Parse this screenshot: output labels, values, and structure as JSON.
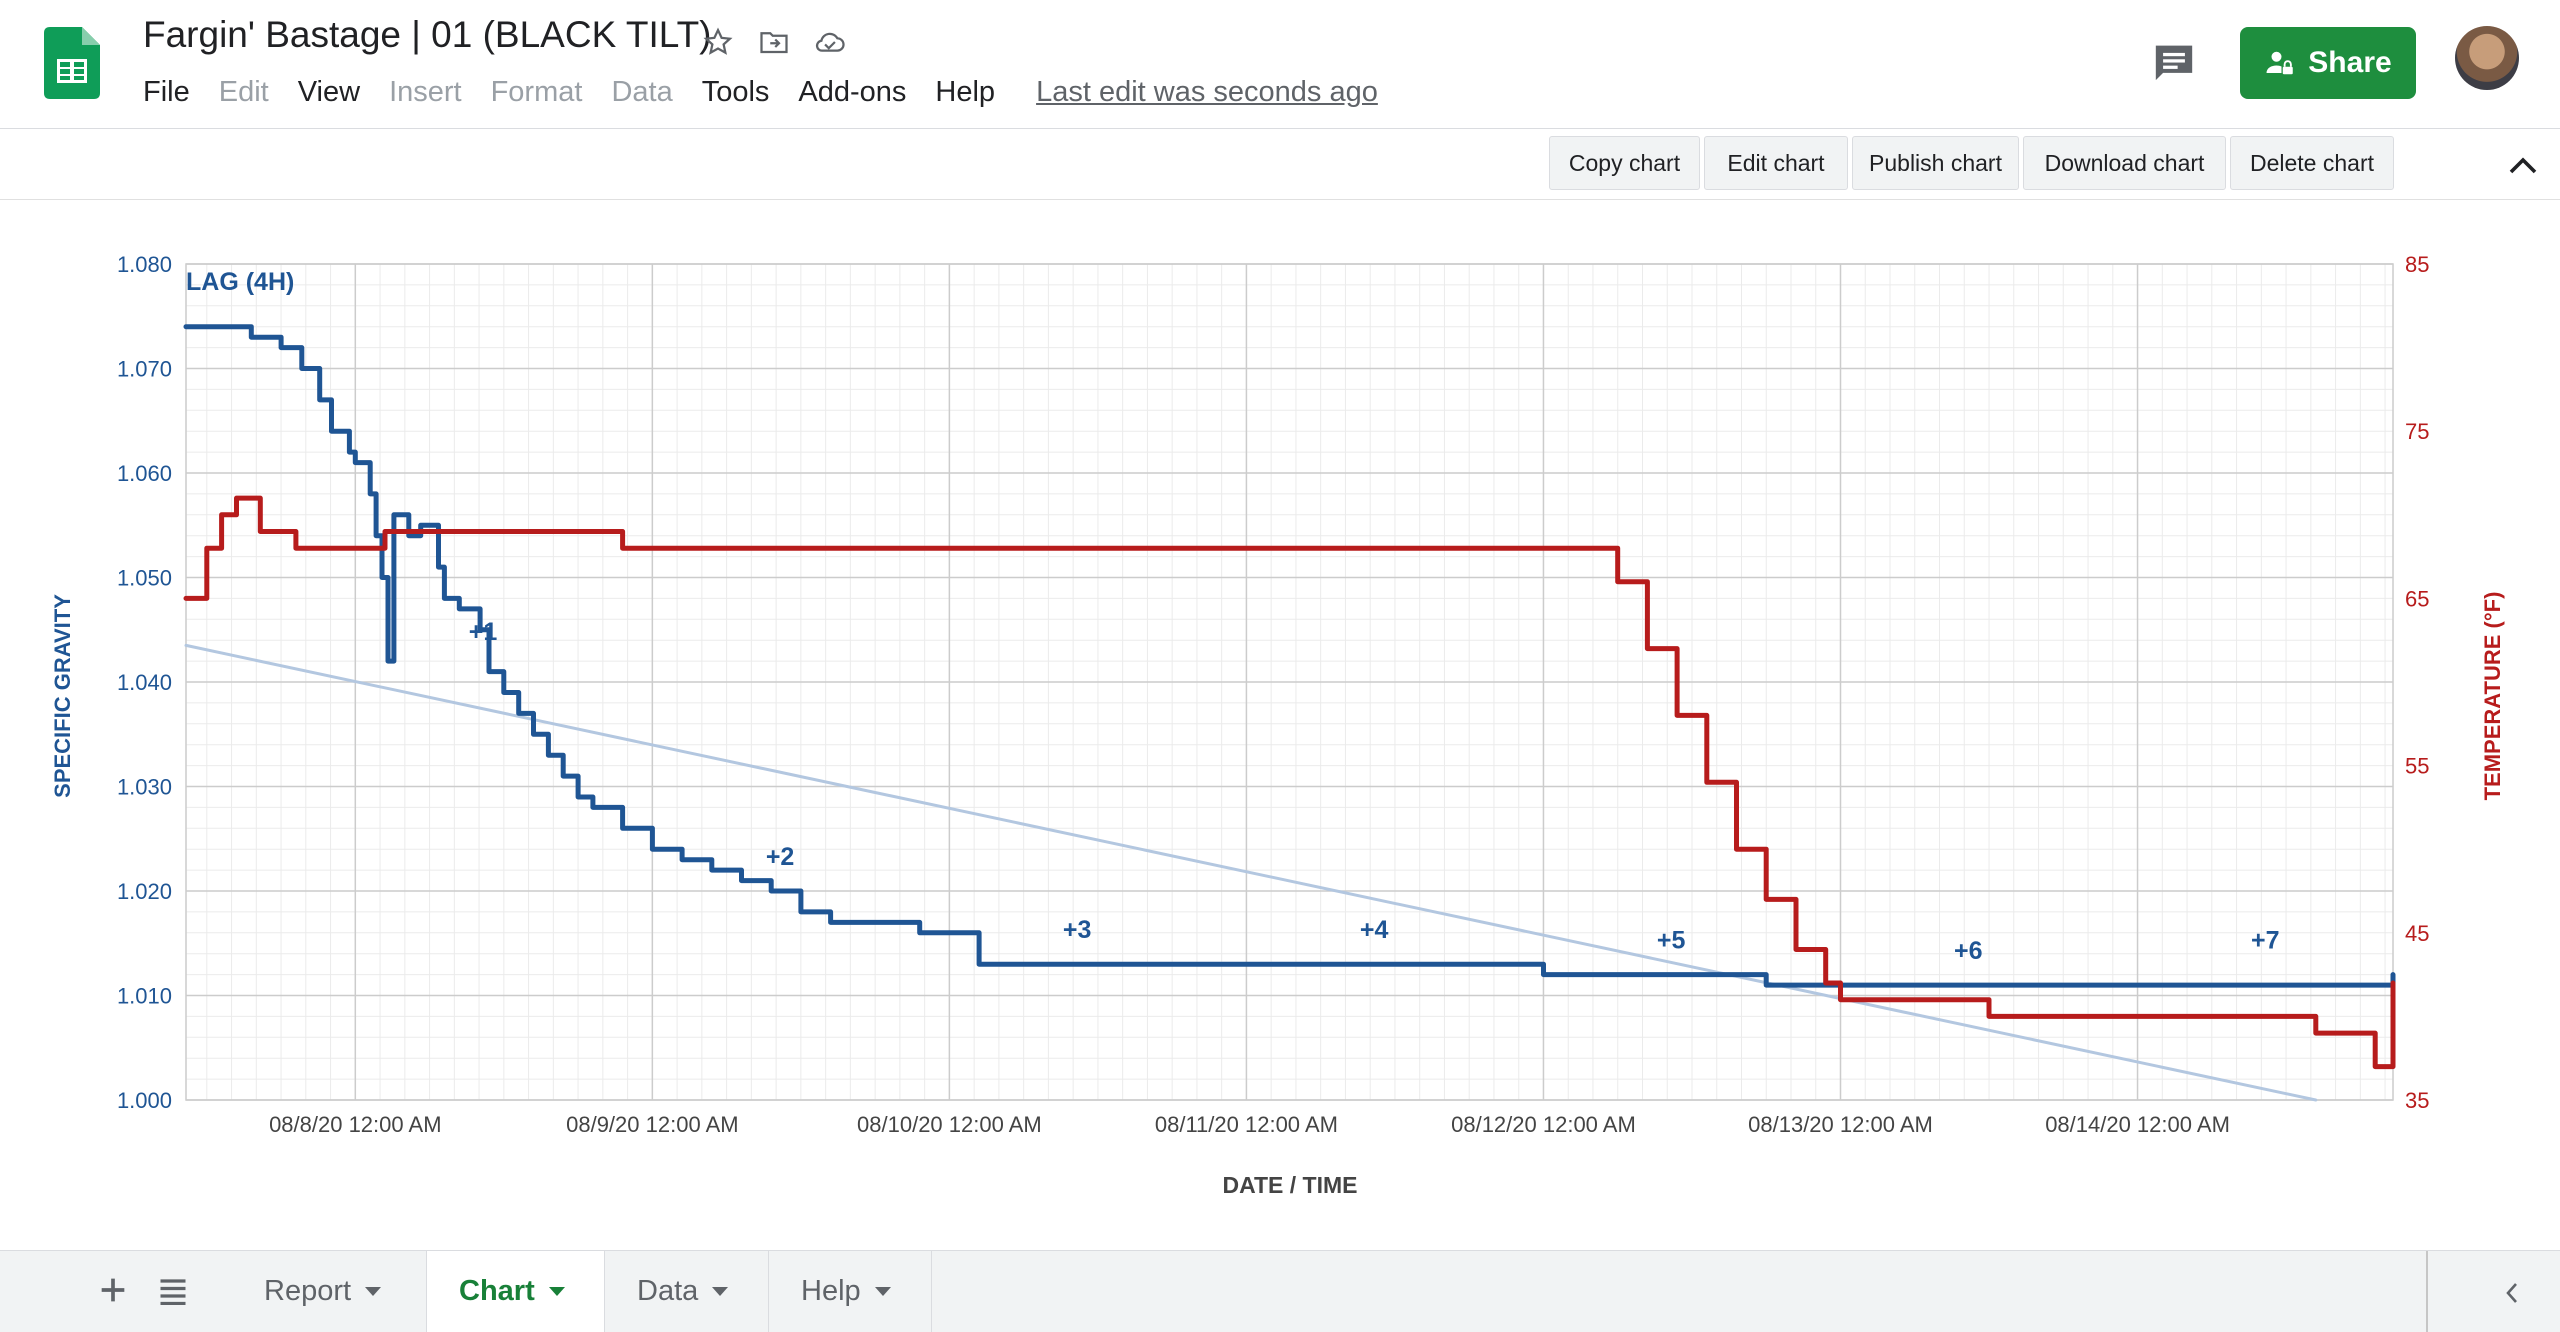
{
  "app": {
    "title": "Fargin' Bastage | 01 (BLACK TILT)",
    "last_edit": "Last edit was seconds ago",
    "share_label": "Share",
    "icons": {
      "logo": "sheets-logo-icon",
      "star": "star-icon",
      "move": "move-to-folder-icon",
      "cloud": "cloud-saved-icon",
      "comment": "comment-icon",
      "share": "lock-person-icon"
    }
  },
  "menu": [
    "File",
    "Edit",
    "View",
    "Insert",
    "Format",
    "Data",
    "Tools",
    "Add-ons",
    "Help"
  ],
  "menu_disabled": [
    "Edit",
    "Insert",
    "Format",
    "Data"
  ],
  "toolbar": {
    "buttons": [
      "Copy chart",
      "Edit chart",
      "Publish chart",
      "Download chart",
      "Delete chart"
    ]
  },
  "tabs": {
    "items": [
      {
        "label": "Report",
        "active": false
      },
      {
        "label": "Chart",
        "active": true
      },
      {
        "label": "Data",
        "active": false
      },
      {
        "label": "Help",
        "active": false
      }
    ]
  },
  "colors": {
    "sg": "#1f5594",
    "temp": "#b71c1c",
    "trend": "#b3c7e0",
    "grid_major": "#cccccc",
    "grid_minor": "#ebebeb",
    "accent": "#1e8e3e"
  },
  "chart_data": {
    "type": "line",
    "xlabel": "DATE / TIME",
    "ylabel_left": "SPECIFIC GRAVITY",
    "ylabel_right": "TEMPERATURE (°F)",
    "x_ticks": [
      "08/8/20 12:00 AM",
      "08/9/20 12:00 AM",
      "08/10/20 12:00 AM",
      "08/11/20 12:00 AM",
      "08/12/20 12:00 AM",
      "08/13/20 12:00 AM",
      "08/14/20 12:00 AM"
    ],
    "x_range_days": [
      7.43,
      14.86
    ],
    "y_left": {
      "ticks": [
        "1.080",
        "1.070",
        "1.060",
        "1.050",
        "1.040",
        "1.030",
        "1.020",
        "1.010",
        "1.000"
      ],
      "range": [
        1.0,
        1.08
      ]
    },
    "y_right": {
      "ticks": [
        "85",
        "75",
        "65",
        "55",
        "45",
        "35"
      ],
      "range": [
        35,
        85
      ]
    },
    "annotations": [
      {
        "text": "LAG (4H)",
        "x": 7.43,
        "y": 1.0775
      },
      {
        "text": "+1",
        "x": 8.43,
        "y": 1.044
      },
      {
        "text": "+2",
        "x": 9.43,
        "y": 1.0225
      },
      {
        "text": "+3",
        "x": 10.43,
        "y": 1.0155
      },
      {
        "text": "+4",
        "x": 11.43,
        "y": 1.0155
      },
      {
        "text": "+5",
        "x": 12.43,
        "y": 1.0145
      },
      {
        "text": "+6",
        "x": 13.43,
        "y": 1.0135
      },
      {
        "text": "+7",
        "x": 14.43,
        "y": 1.0145
      }
    ],
    "series": [
      {
        "axis": "left",
        "x": [
          7.43,
          7.6,
          7.65,
          7.75,
          7.82,
          7.88,
          7.92,
          7.98,
          8.0,
          8.05,
          8.07,
          8.09,
          8.11,
          8.13,
          8.18,
          8.22,
          8.28,
          8.3,
          8.35,
          8.42,
          8.45,
          8.5,
          8.55,
          8.6,
          8.65,
          8.7,
          8.75,
          8.8,
          8.9,
          9.0,
          9.1,
          9.2,
          9.3,
          9.4,
          9.5,
          9.6,
          9.75,
          9.9,
          10.1,
          10.2,
          10.3,
          10.4,
          10.5,
          10.7,
          11.0,
          11.3,
          11.6,
          11.95,
          12.0,
          12.2,
          12.45,
          12.6,
          12.75,
          12.9,
          13.2,
          13.3,
          13.45,
          13.6,
          13.8,
          14.0,
          14.3,
          14.6,
          14.8,
          14.86
        ],
        "y": [
          1.074,
          1.074,
          1.073,
          1.072,
          1.07,
          1.067,
          1.064,
          1.062,
          1.061,
          1.058,
          1.054,
          1.05,
          1.042,
          1.056,
          1.054,
          1.055,
          1.051,
          1.048,
          1.047,
          1.045,
          1.041,
          1.039,
          1.037,
          1.035,
          1.033,
          1.031,
          1.029,
          1.028,
          1.026,
          1.024,
          1.023,
          1.022,
          1.021,
          1.02,
          1.018,
          1.017,
          1.017,
          1.016,
          1.013,
          1.013,
          1.013,
          1.013,
          1.013,
          1.013,
          1.013,
          1.013,
          1.013,
          1.013,
          1.012,
          1.012,
          1.012,
          1.012,
          1.011,
          1.011,
          1.011,
          1.011,
          1.011,
          1.011,
          1.011,
          1.011,
          1.011,
          1.011,
          1.011,
          1.012
        ]
      },
      {
        "axis": "right",
        "x": [
          7.43,
          7.5,
          7.55,
          7.6,
          7.63,
          7.68,
          7.8,
          8.0,
          8.1,
          8.3,
          8.5,
          8.8,
          8.9,
          9.0,
          9.5,
          10.5,
          11.5,
          12.15,
          12.25,
          12.35,
          12.45,
          12.55,
          12.65,
          12.75,
          12.85,
          12.95,
          13.0,
          13.5,
          13.9,
          14.0,
          14.5,
          14.6,
          14.75,
          14.8,
          14.86
        ],
        "y": [
          65,
          68,
          70,
          71,
          71,
          69,
          68,
          68,
          69,
          69,
          69,
          69,
          68,
          68,
          68,
          68,
          68,
          68,
          66,
          62,
          58,
          54,
          50,
          47,
          44,
          42,
          41,
          40,
          40,
          40,
          40,
          39,
          39,
          37,
          42
        ]
      },
      {
        "axis": "left",
        "x": [
          7.43,
          14.6
        ],
        "y": [
          1.0435,
          1.0
        ]
      }
    ]
  }
}
